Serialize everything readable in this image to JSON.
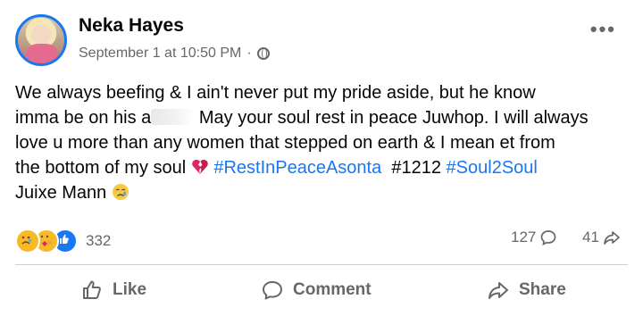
{
  "post": {
    "author": "Neka Hayes",
    "timestamp": "September 1 at 10:50 PM",
    "separator": "·",
    "privacy_icon": "globe-icon",
    "text_line1": "We always beefing & I ain't never put my pride aside, but he know",
    "text_line2a": "imma be on his a",
    "text_line2b": " May your soul rest in peace Juwhop. I will always",
    "text_line3": "love u more than any women that stepped on earth & I mean et from",
    "text_line4a": "the bottom of my soul ",
    "hashtag1": "#RestInPeaceAsonta",
    "text_line4b": "#1212",
    "hashtag2": "#Soul2Soul",
    "text_line5": "Juixe Mann",
    "emojis": [
      "broken-heart-emoji",
      "crying-face-emoji"
    ]
  },
  "stats": {
    "reactions_count": "332",
    "reaction_icons": [
      "sad-reaction-icon",
      "care-reaction-icon",
      "like-reaction-icon"
    ],
    "comments_count": "127",
    "shares_count": "41"
  },
  "actions": {
    "like": "Like",
    "comment": "Comment",
    "share": "Share"
  },
  "colors": {
    "accent": "#1877f2",
    "secondary_text": "#65676b",
    "divider": "#ced0d4"
  }
}
